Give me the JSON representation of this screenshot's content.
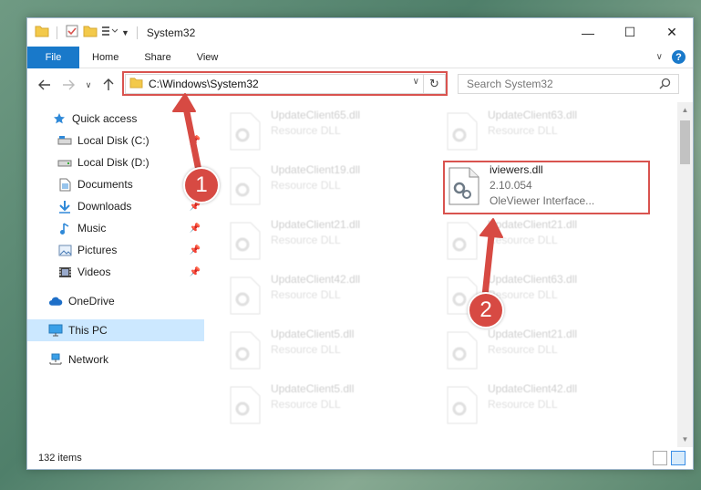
{
  "window": {
    "title": "System32",
    "controls": [
      "—",
      "☐",
      "✕"
    ]
  },
  "ribbon": {
    "file_tab": "File",
    "tabs": [
      "Home",
      "Share",
      "View"
    ],
    "help": "?"
  },
  "navigation": {
    "address": "C:\\Windows\\System32",
    "search_placeholder": "Search System32"
  },
  "sidebar": {
    "items": [
      {
        "label": "Quick access",
        "icon": "star-icon",
        "pinned": false
      },
      {
        "label": "Local Disk (C:)",
        "icon": "drive-icon",
        "pinned": true
      },
      {
        "label": "Local Disk (D:)",
        "icon": "drive-icon",
        "pinned": true
      },
      {
        "label": "Documents",
        "icon": "documents-icon",
        "pinned": true
      },
      {
        "label": "Downloads",
        "icon": "download-icon",
        "pinned": true
      },
      {
        "label": "Music",
        "icon": "music-icon",
        "pinned": true
      },
      {
        "label": "Pictures",
        "icon": "pictures-icon",
        "pinned": true
      },
      {
        "label": "Videos",
        "icon": "videos-icon",
        "pinned": true
      },
      {
        "label": "OneDrive",
        "icon": "cloud-icon",
        "pinned": false
      },
      {
        "label": "This PC",
        "icon": "computer-icon",
        "pinned": false,
        "selected": true
      },
      {
        "label": "Network",
        "icon": "network-icon",
        "pinned": false
      }
    ]
  },
  "files": {
    "left_column": [
      {
        "name": "UpdateClient65.dll",
        "desc": "Resource DLL"
      },
      {
        "name": "UpdateClient19.dll",
        "desc": "Resource DLL"
      },
      {
        "name": "UpdateClient21.dll",
        "desc": "Resource DLL"
      },
      {
        "name": "UpdateClient42.dll",
        "desc": "Resource DLL"
      },
      {
        "name": "UpdateClient5.dll",
        "desc": "Resource DLL"
      },
      {
        "name": "UpdateClient5.dll",
        "desc": "Resource DLL"
      }
    ],
    "right_column": [
      {
        "name": "UpdateClient63.dll",
        "desc": "Resource DLL"
      },
      {
        "name": "iviewers.dll",
        "version": "2.10.054",
        "desc": "OleViewer Interface...",
        "highlighted": true
      },
      {
        "name": "UpdateClient21.dll",
        "desc": "Resource DLL"
      },
      {
        "name": "UpdateClient63.dll",
        "desc": "Resource DLL"
      },
      {
        "name": "UpdateClient21.dll",
        "desc": "Resource DLL"
      },
      {
        "name": "UpdateClient42.dll",
        "desc": "Resource DLL"
      }
    ]
  },
  "status": {
    "item_count": "132 items"
  },
  "annotations": {
    "badge_1": "1",
    "badge_2": "2",
    "color": "#d74a43"
  }
}
